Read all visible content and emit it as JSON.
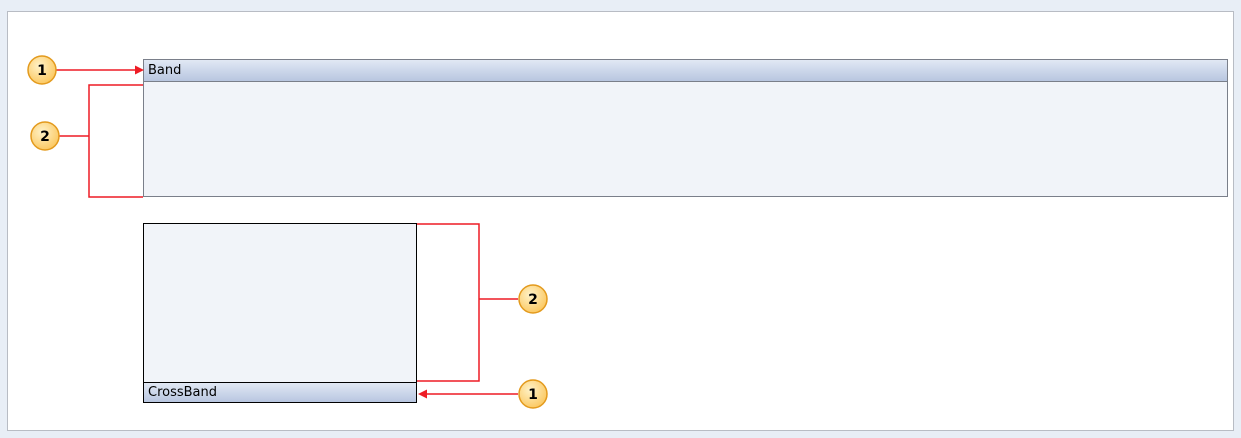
{
  "band": {
    "label": "Band"
  },
  "crossband": {
    "label": "CrossBand"
  },
  "callouts": [
    {
      "id": "top-1",
      "number": "1"
    },
    {
      "id": "top-2",
      "number": "2"
    },
    {
      "id": "bottom-2",
      "number": "2"
    },
    {
      "id": "bottom-1",
      "number": "1"
    }
  ],
  "colors": {
    "leader_line": "#ee1c25",
    "callout_fill": "#fdd58a",
    "callout_stroke": "#e39a1d",
    "header_gradient_top": "#e1e8f4",
    "header_gradient_bottom": "#b8c6e0",
    "band_body": "#f1f4f9"
  }
}
